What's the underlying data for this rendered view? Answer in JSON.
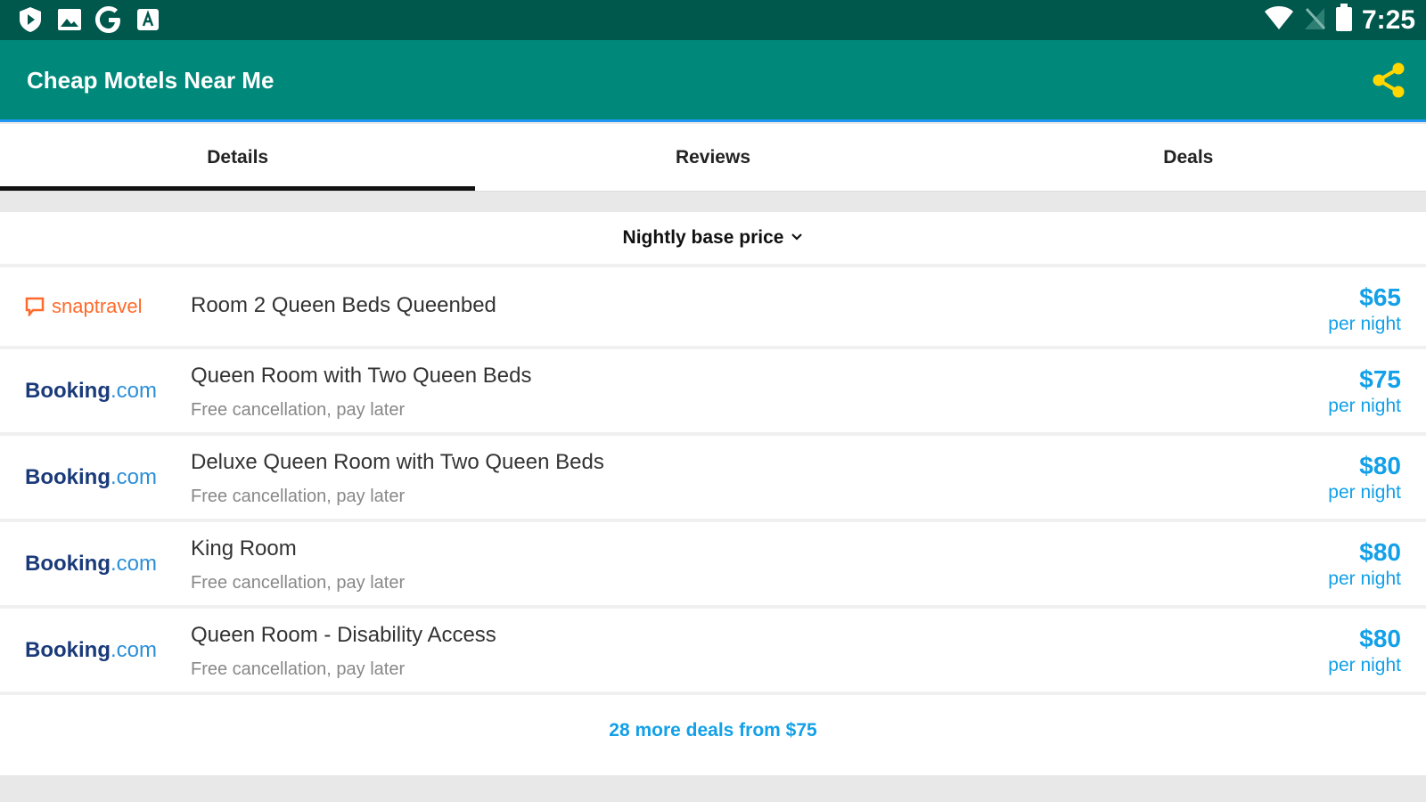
{
  "status_bar": {
    "time": "7:25",
    "left_icons": [
      "play-shield-icon",
      "image-icon",
      "google-icon",
      "app-store-icon"
    ],
    "right_icons": [
      "wifi-icon",
      "no-signal-icon",
      "battery-icon"
    ]
  },
  "app_bar": {
    "title": "Cheap Motels Near Me",
    "share_icon": "share-icon",
    "accent_color": "#ffd600"
  },
  "tabs": [
    {
      "label": "Details",
      "active": true
    },
    {
      "label": "Reviews",
      "active": false
    },
    {
      "label": "Deals",
      "active": false
    }
  ],
  "sort": {
    "label": "Nightly base price",
    "icon": "chevron-down-icon"
  },
  "deals": [
    {
      "provider": "snaptravel",
      "title": "Room 2 Queen Beds Queenbed",
      "subtitle": "",
      "price": "$65",
      "unit": "per night"
    },
    {
      "provider": "Booking.com",
      "title": "Queen Room with Two Queen Beds",
      "subtitle": "Free cancellation, pay later",
      "price": "$75",
      "unit": "per night"
    },
    {
      "provider": "Booking.com",
      "title": "Deluxe Queen Room with Two Queen Beds",
      "subtitle": "Free cancellation, pay later",
      "price": "$80",
      "unit": "per night"
    },
    {
      "provider": "Booking.com",
      "title": "King Room",
      "subtitle": "Free cancellation, pay later",
      "price": "$80",
      "unit": "per night"
    },
    {
      "provider": "Booking.com",
      "title": "Queen Room - Disability Access",
      "subtitle": "Free cancellation, pay later",
      "price": "$80",
      "unit": "per night"
    }
  ],
  "more_deals": "28 more deals from $75",
  "colors": {
    "status_bar": "#00574b",
    "app_bar": "#00897b",
    "price": "#12a0e8",
    "booking_dark": "#1a3a7a",
    "booking_light": "#2a8fd8",
    "snaptravel": "#ff6a2a"
  }
}
